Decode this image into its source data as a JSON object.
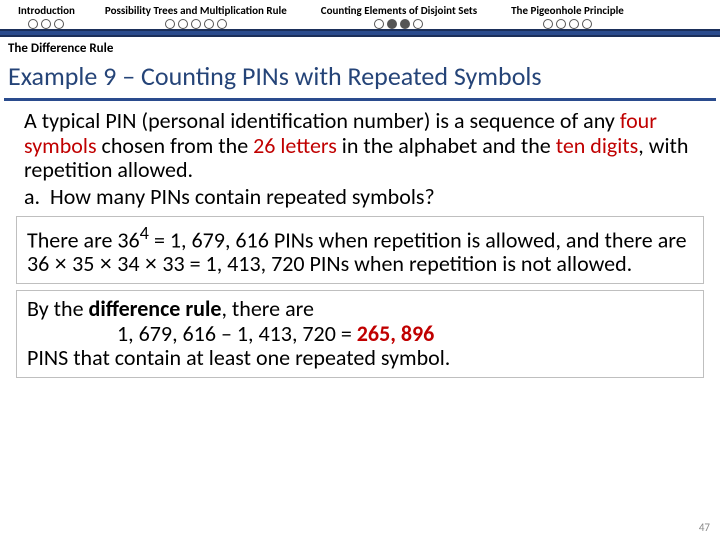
{
  "nav": {
    "items": [
      {
        "label": "Introduction",
        "dots": [
          0,
          0,
          0
        ]
      },
      {
        "label": "Possibility Trees and Multiplication Rule",
        "dots": [
          0,
          0,
          0,
          0,
          0
        ]
      },
      {
        "label": "Counting Elements of Disjoint Sets",
        "dots": [
          0,
          1,
          1,
          0
        ]
      },
      {
        "label": "The Pigeonhole Principle",
        "dots": [
          0,
          0,
          0,
          0
        ]
      }
    ]
  },
  "subhead": "The Difference Rule",
  "title": "Example 9 – Counting PINs with Repeated Symbols",
  "body": {
    "text_before_four": "A typical PIN (personal identification number) is a sequence of any ",
    "four_symbols": "four symbols",
    "text_mid1": " chosen from the ",
    "twenty_six": "26 letters",
    "text_mid2": " in the alphabet and the ",
    "ten_digits": "ten digits",
    "text_after": ", with repetition allowed.",
    "q_label": "a.",
    "q_text": "How many PINs contain repeated symbols?"
  },
  "box1": {
    "lead": "There are 36",
    "exp": "4",
    "eq": " = 1, 679, 616 PINs when repetition is allowed, and there are 36 ",
    "times": "×",
    "p2": " 35 ",
    "p3": " 34 ",
    "p4": " 33 = 1, 413, 720 PINs when repetition is not allowed."
  },
  "box2": {
    "line1a": "By the ",
    "line1b": "difference rule",
    "line1c": ", there are",
    "calc_left": "1, 679, 616 – 1, 413, 720 = ",
    "calc_result": "265, 896",
    "line3": "PINS that contain at least one repeated symbol."
  },
  "page": "47"
}
